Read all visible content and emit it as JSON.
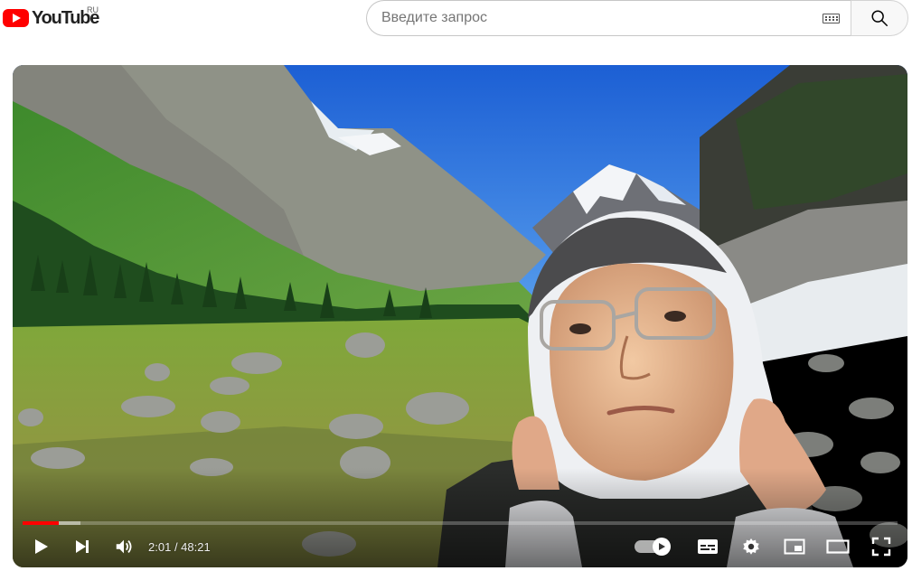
{
  "header": {
    "logo_text": "YouTube",
    "logo_region": "RU",
    "search": {
      "placeholder": "Введите запрос",
      "value": ""
    },
    "icons": [
      "youtube-logo-icon",
      "keyboard-icon",
      "search-icon"
    ]
  },
  "player": {
    "time_current": "2:01",
    "time_total": "48:21",
    "progress_fraction": 0.0417,
    "buffered_fraction": 0.066,
    "autoplay_on": true,
    "icons": [
      "play-icon",
      "next-icon",
      "volume-icon",
      "autoplay-toggle-icon",
      "subtitles-icon",
      "settings-icon",
      "miniplayer-icon",
      "theater-mode-icon",
      "fullscreen-icon"
    ],
    "colors": {
      "progress": "#ff0000",
      "brand": "#ff0000"
    }
  }
}
